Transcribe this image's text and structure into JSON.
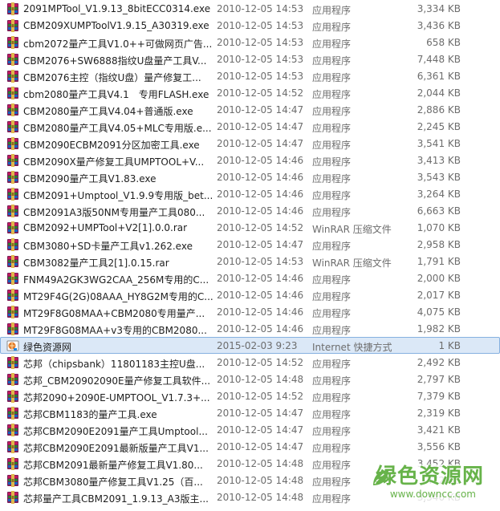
{
  "file_list": [
    {
      "name": "2091MPTool_V1.9.13_8bitECC0314.exe",
      "date": "2010-12-05 14:53",
      "type": "应用程序",
      "size": "3,334 KB",
      "icon": "rar-archive-icon"
    },
    {
      "name": "CBM209XUMPToolV1.9.15_A30319.exe",
      "date": "2010-12-05 14:53",
      "type": "应用程序",
      "size": "3,436 KB",
      "icon": "rar-archive-icon"
    },
    {
      "name": "cbm2072量产工具V1.0++可做网页广告...",
      "date": "2010-12-05 14:53",
      "type": "应用程序",
      "size": "658 KB",
      "icon": "rar-archive-icon"
    },
    {
      "name": "CBM2076+SW6888指纹U盘量产工具V...",
      "date": "2010-12-05 14:53",
      "type": "应用程序",
      "size": "7,448 KB",
      "icon": "rar-archive-icon"
    },
    {
      "name": "CBM2076主控（指纹U盘）量产修复工...",
      "date": "2010-12-05 14:53",
      "type": "应用程序",
      "size": "6,361 KB",
      "icon": "rar-archive-icon"
    },
    {
      "name": "cbm2080量产工具V4.1　专用FLASH.exe",
      "date": "2010-12-05 14:52",
      "type": "应用程序",
      "size": "2,044 KB",
      "icon": "rar-archive-icon"
    },
    {
      "name": "CBM2080量产工具V4.04+普通版.exe",
      "date": "2010-12-05 14:47",
      "type": "应用程序",
      "size": "2,886 KB",
      "icon": "rar-archive-icon"
    },
    {
      "name": "CBM2080量产工具V4.05+MLC专用版.e...",
      "date": "2010-12-05 14:47",
      "type": "应用程序",
      "size": "2,245 KB",
      "icon": "rar-archive-icon"
    },
    {
      "name": "CBM2090ECBM2091分区加密工具.exe",
      "date": "2010-12-05 14:47",
      "type": "应用程序",
      "size": "3,541 KB",
      "icon": "rar-archive-icon"
    },
    {
      "name": "CBM2090X量产修复工具UMPTOOL+V...",
      "date": "2010-12-05 14:46",
      "type": "应用程序",
      "size": "3,413 KB",
      "icon": "rar-archive-icon"
    },
    {
      "name": "CBM2090量产工具V1.83.exe",
      "date": "2010-12-05 14:46",
      "type": "应用程序",
      "size": "3,543 KB",
      "icon": "rar-archive-icon"
    },
    {
      "name": "CBM2091+Umptool_V1.9.9专用版_bet...",
      "date": "2010-12-05 14:46",
      "type": "应用程序",
      "size": "3,264 KB",
      "icon": "rar-archive-icon"
    },
    {
      "name": "CBM2091A3版50NM专用量产工具080...",
      "date": "2010-12-05 14:46",
      "type": "应用程序",
      "size": "6,663 KB",
      "icon": "rar-archive-icon"
    },
    {
      "name": "CBM2092+UMPTool+V2[1].0.0.rar",
      "date": "2010-12-05 14:52",
      "type": "WinRAR 压缩文件",
      "size": "1,070 KB",
      "icon": "rar-archive-icon"
    },
    {
      "name": "CBM3080+SD卡量产工具v1.262.exe",
      "date": "2010-12-05 14:47",
      "type": "应用程序",
      "size": "2,958 KB",
      "icon": "rar-archive-icon"
    },
    {
      "name": "CBM3082量产工具2[1].0.15.rar",
      "date": "2010-12-05 14:53",
      "type": "WinRAR 压缩文件",
      "size": "1,791 KB",
      "icon": "rar-archive-icon"
    },
    {
      "name": "FNM49A2GK3WG2CAA_256M专用的C...",
      "date": "2010-12-05 14:46",
      "type": "应用程序",
      "size": "2,000 KB",
      "icon": "rar-archive-icon"
    },
    {
      "name": "MT29F4G(2G)08AAA_HY8G2M专用的C...",
      "date": "2010-12-05 14:46",
      "type": "应用程序",
      "size": "2,017 KB",
      "icon": "rar-archive-icon"
    },
    {
      "name": "MT29F8G08MAA+CBM2080专用量产...",
      "date": "2010-12-05 14:46",
      "type": "应用程序",
      "size": "4,075 KB",
      "icon": "rar-archive-icon"
    },
    {
      "name": "MT29F8G08MAA+v3专用的CBM2080...",
      "date": "2010-12-05 14:46",
      "type": "应用程序",
      "size": "1,982 KB",
      "icon": "rar-archive-icon"
    },
    {
      "name": "绿色资源网",
      "date": "2015-02-03 9:23",
      "type": "Internet 快捷方式",
      "size": "1 KB",
      "icon": "internet-shortcut-icon",
      "selected": true
    },
    {
      "name": "芯邦（chipsbank）11801183主控U盘...",
      "date": "2010-12-05 14:52",
      "type": "应用程序",
      "size": "2,492 KB",
      "icon": "rar-archive-icon"
    },
    {
      "name": "芯邦_CBM20902090E量产修复工具软件...",
      "date": "2010-12-05 14:48",
      "type": "应用程序",
      "size": "2,797 KB",
      "icon": "rar-archive-icon"
    },
    {
      "name": "芯邦2090+2090E-UMPTOOL_V1.7.3+...",
      "date": "2010-12-05 14:52",
      "type": "应用程序",
      "size": "7,379 KB",
      "icon": "rar-archive-icon"
    },
    {
      "name": "芯邦CBM1183的量产工具.exe",
      "date": "2010-12-05 14:47",
      "type": "应用程序",
      "size": "2,319 KB",
      "icon": "rar-archive-icon"
    },
    {
      "name": "芯邦CBM2090E2091量产工具Umptool...",
      "date": "2010-12-05 14:47",
      "type": "应用程序",
      "size": "3,421 KB",
      "icon": "rar-archive-icon"
    },
    {
      "name": "芯邦CBM2090E2091最新版量产工具V1...",
      "date": "2010-12-05 14:47",
      "type": "应用程序",
      "size": "3,556 KB",
      "icon": "rar-archive-icon"
    },
    {
      "name": "芯邦CBM2091最新量产修复工具V1.80...",
      "date": "2010-12-05 14:48",
      "type": "应用程序",
      "size": "3,452 KB",
      "icon": "rar-archive-icon"
    },
    {
      "name": "芯邦CBM3080量产修复工具V1.25（百...",
      "date": "2010-12-05 14:48",
      "type": "应用程序",
      "size": "472 KB",
      "icon": "rar-archive-icon"
    },
    {
      "name": "芯邦量产工具CBM2091_1.9.13_A3版主...",
      "date": "2010-12-05 14:48",
      "type": "应用程序",
      "size": "3,340 KB",
      "icon": "rar-archive-icon"
    }
  ],
  "watermark": {
    "title": "绿色资源网",
    "url": "www.downcc.com",
    "color": "#67b34a"
  }
}
